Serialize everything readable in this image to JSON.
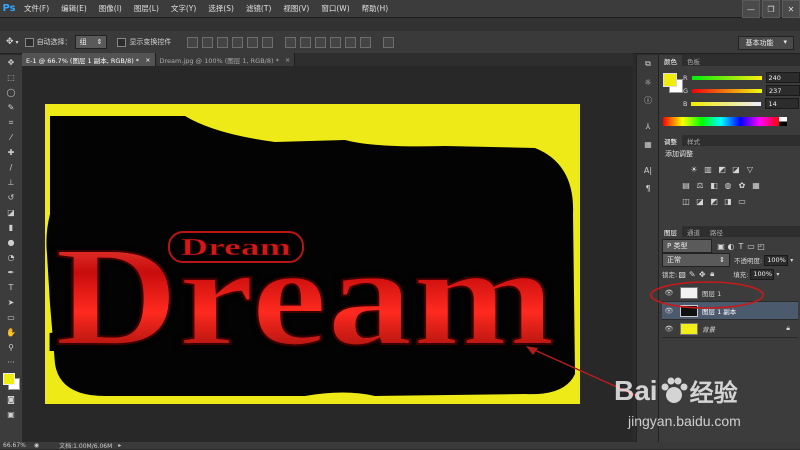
{
  "app": {
    "logo": "Ps"
  },
  "menu": [
    "文件(F)",
    "编辑(E)",
    "图像(I)",
    "图层(L)",
    "文字(Y)",
    "选择(S)",
    "滤镜(T)",
    "视图(V)",
    "窗口(W)",
    "帮助(H)"
  ],
  "window_controls": {
    "minimize": "—",
    "restore": "❐",
    "close": "✕"
  },
  "options": {
    "auto_select_label": "自动选择：",
    "auto_select_value": "组",
    "show_transform_label": "显示变换控件",
    "workspace": "基本功能"
  },
  "tabs": [
    {
      "label": "E-1 @ 66.7% (图层 1 副本, RGB/8) *",
      "close": "×"
    },
    {
      "label": "Dream.jpg @ 100% (图层 1, RGB/8) *",
      "close": "×"
    }
  ],
  "canvas": {
    "big_text": "Dream",
    "small_text": "Dream",
    "background_color": "#eeea18",
    "text_color": "#d31212"
  },
  "color_panel": {
    "tabs": [
      "颜色",
      "色板"
    ],
    "r_label": "R",
    "r_value": "240",
    "g_label": "G",
    "g_value": "237",
    "b_label": "B",
    "b_value": "14",
    "foreground": "#f0ed0e",
    "background": "#ffffff"
  },
  "adjust_panel": {
    "tabs": [
      "调整",
      "样式"
    ],
    "title": "添加调整"
  },
  "layers_panel": {
    "tabs": [
      "图层",
      "通道",
      "路径"
    ],
    "filter_label": "P 类型",
    "blend_mode": "正常",
    "opacity_label": "不透明度:",
    "opacity_value": "100%",
    "lock_label": "锁定:",
    "fill_label": "填充:",
    "fill_value": "100%",
    "layers": [
      {
        "name": "图层 1",
        "thumb_color": "#f2f2f2"
      },
      {
        "name": "图层 1 副本",
        "thumb_color": "#111111"
      },
      {
        "name": "背景",
        "thumb_color": "#f2ee18"
      }
    ]
  },
  "status": {
    "zoom": "66.67%",
    "doc_info": "文档:1.00M/6.06M"
  },
  "watermark": {
    "brand_left": "Bai",
    "brand_right": "经验",
    "url": "jingyan.baidu.com"
  },
  "colors": {
    "accent_blue": "#31a8ff",
    "highlight_ellipse": "#c41b1b",
    "arrow": "#b51d1d"
  }
}
